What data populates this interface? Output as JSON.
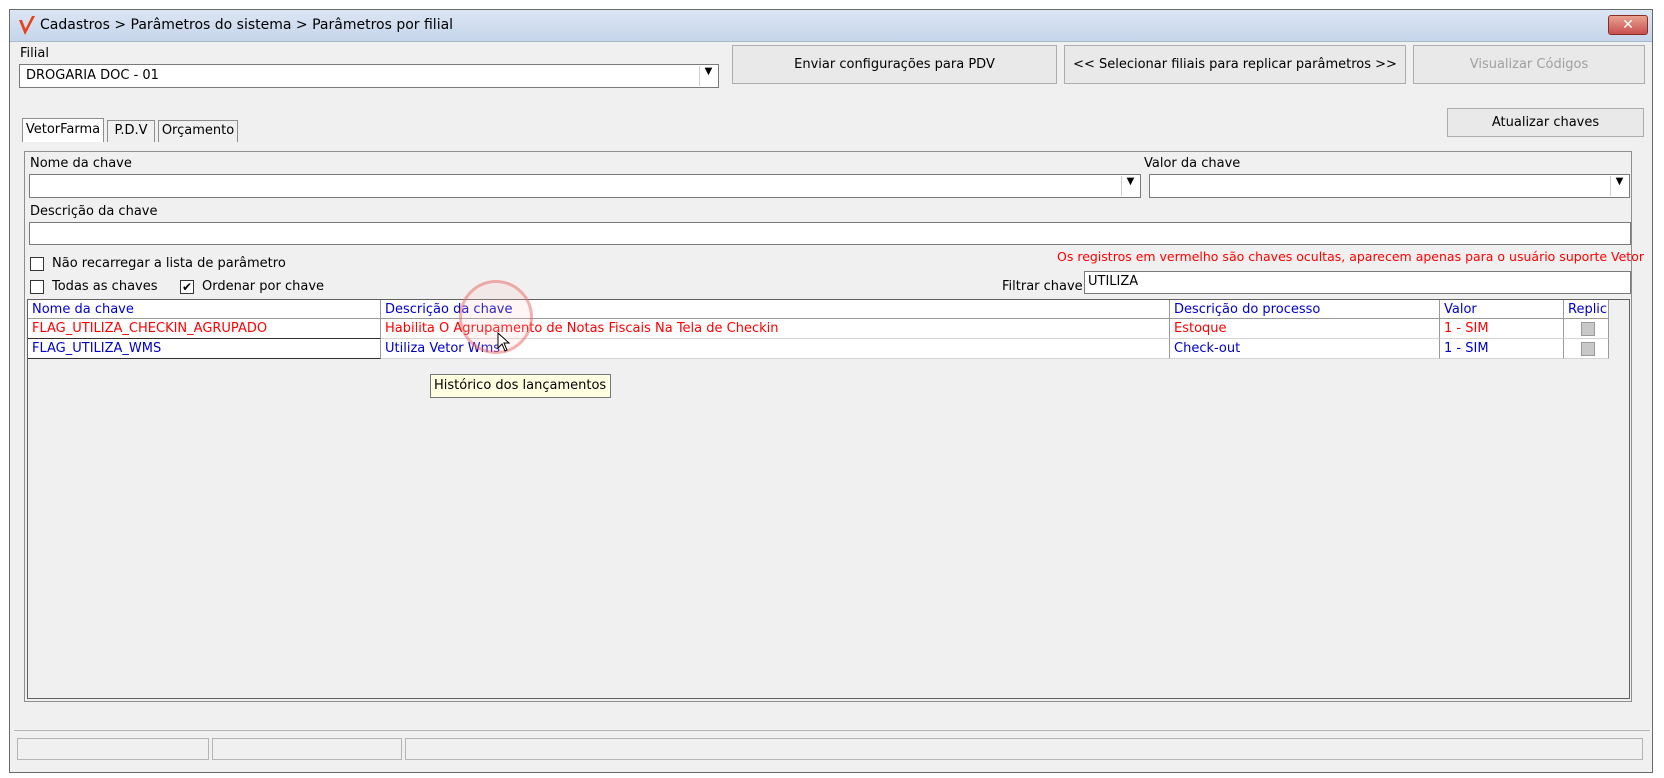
{
  "window": {
    "title": "Cadastros > Parâmetros do sistema > Parâmetros por filial",
    "close_icon": "close-x-icon"
  },
  "filial": {
    "label": "Filial",
    "value": "DROGARIA DOC - 01"
  },
  "toolbar": {
    "send_pdv": "Enviar configurações para  PDV",
    "select_branches": "<< Selecionar filiais para replicar parâmetros >>",
    "view_codes": "Visualizar Códigos",
    "update_keys": "Atualizar chaves"
  },
  "tabs": [
    {
      "label": "VetorFarma",
      "active": true
    },
    {
      "label": "P.D.V",
      "active": false
    },
    {
      "label": "Orçamento",
      "active": false
    }
  ],
  "form": {
    "key_name_label": "Nome da chave",
    "key_value_label": "Valor da chave",
    "key_desc_label": "Descrição da chave",
    "no_reload_label": "Não recarregar a lista de parâmetro",
    "all_keys_label": "Todas as chaves",
    "order_by_key_label": "Ordenar por chave",
    "no_reload_checked": false,
    "all_keys_checked": false,
    "order_by_key_checked": true,
    "hidden_notice": "Os registros em vermelho são chaves ocultas, aparecem apenas para o usuário suporte Vetor",
    "filter_label": "Filtrar chave",
    "filter_value": "UTILIZA"
  },
  "grid": {
    "columns": [
      "Nome da chave",
      "Descrição  da chave",
      "Descrição do processo",
      "Valor",
      "Replic"
    ],
    "rows": [
      {
        "name": "FLAG_UTILIZA_CHECKIN_AGRUPADO",
        "description": "Habilita O Agrupamento de Notas Fiscais Na Tela de Checkin",
        "process": "Estoque",
        "value": "1 - SIM",
        "hidden": true
      },
      {
        "name": "FLAG_UTILIZA_WMS",
        "description": "Utiliza Vetor Wms",
        "process": "Check-out",
        "value": "1 - SIM",
        "hidden": false
      }
    ]
  },
  "tooltip": "Histórico dos lançamentos",
  "colors": {
    "hidden_row": "#ff0000",
    "normal_row": "#0000cc",
    "header_text": "#0000cc"
  }
}
